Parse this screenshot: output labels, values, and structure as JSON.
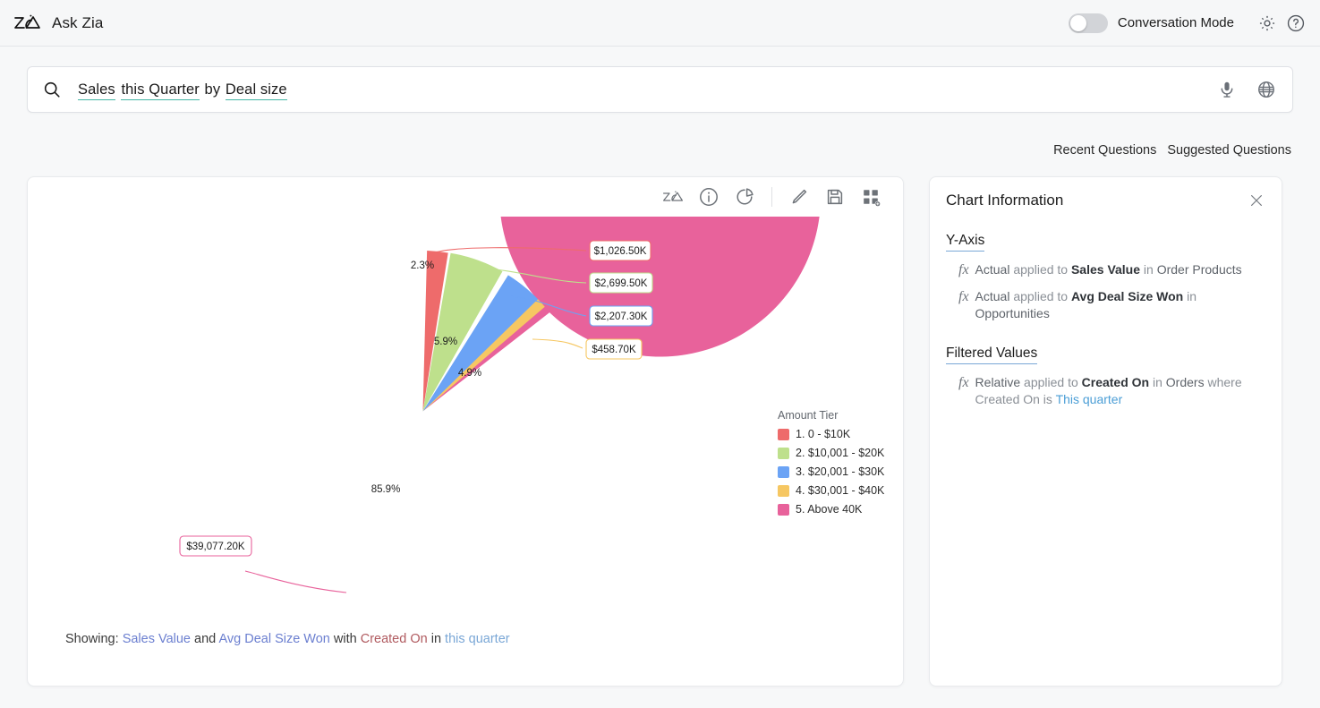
{
  "header": {
    "logo_icon": "zia-logo-icon",
    "title": "Ask Zia",
    "toggle_label": "Conversation Mode",
    "toggle_on": false,
    "settings_icon": "gear-icon",
    "help_icon": "help-circle-icon"
  },
  "search": {
    "icon": "search-icon",
    "tokens": [
      {
        "text": "Sales",
        "underlined": true
      },
      {
        "text": " ",
        "underlined": false
      },
      {
        "text": "this Quarter",
        "underlined": true
      },
      {
        "text": " by ",
        "underlined": false
      },
      {
        "text": "Deal size",
        "underlined": true
      }
    ],
    "full_value": "Sales this Quarter by Deal size",
    "placeholder": "Ask a question",
    "mic_icon": "microphone-icon",
    "globe_icon": "globe-icon"
  },
  "question_links": [
    {
      "label": "Recent Questions"
    },
    {
      "label": "Suggested Questions"
    }
  ],
  "chart_toolbar": [
    {
      "name": "zia-insights-icon"
    },
    {
      "name": "info-circle-icon"
    },
    {
      "name": "pie-chart-icon"
    },
    {
      "name": "divider"
    },
    {
      "name": "edit-pencil-icon"
    },
    {
      "name": "save-disk-icon"
    },
    {
      "name": "widget-grid-icon"
    }
  ],
  "chart_data": {
    "type": "pie",
    "title": "",
    "legend_title": "Amount Tier",
    "legend_position": "right",
    "categories": [
      "1. 0 - $10K",
      "2. $10,001 - $20K",
      "3. $20,001 - $30K",
      "4. $30,001 - $40K",
      "5. Above 40K"
    ],
    "values": [
      1026.5,
      2699.5,
      2207.3,
      458.7,
      39077.2
    ],
    "value_labels": [
      "$1,026.50K",
      "$2,699.50K",
      "$2,207.30K",
      "$458.70K",
      "$39,077.20K"
    ],
    "percent_labels": [
      "2.3%",
      "5.9%",
      "4.9%",
      "1.0%",
      "85.9%"
    ],
    "shown_percent_labels": [
      "2.3%",
      "5.9%",
      "4.9%",
      "85.9%"
    ],
    "colors": [
      "#ee6b6b",
      "#bee08c",
      "#6ba3f5",
      "#f6c762",
      "#e8629b"
    ],
    "unit": "K",
    "xlabel": "",
    "ylabel": ""
  },
  "showing": {
    "prefix": "Showing:",
    "metric1": "Sales Value",
    "conj": "and",
    "metric2": "Avg Deal Size Won",
    "with": "with",
    "field": "Created On",
    "in": "in",
    "period": "this quarter"
  },
  "info_panel": {
    "title": "Chart Information",
    "close_icon": "close-icon",
    "sections": [
      {
        "title": "Y-Axis",
        "rows": [
          {
            "glyph": "fx",
            "p1": "Actual",
            "p2": " applied to ",
            "bold": "Sales Value",
            "p3": " in ",
            "p4": "Order Products",
            "p5": "",
            "link": ""
          },
          {
            "glyph": "fx",
            "p1": "Actual",
            "p2": " applied to ",
            "bold": "Avg Deal Size Won",
            "p3": " in ",
            "p4": "Opportunities",
            "p5": "",
            "link": ""
          }
        ]
      },
      {
        "title": "Filtered Values",
        "rows": [
          {
            "glyph": "fx",
            "p1": "Relative",
            "p2": " applied to ",
            "bold": "Created On",
            "p3": " in ",
            "p4": "Orders",
            "p5": " where Created On is ",
            "link": "This quarter"
          }
        ]
      }
    ]
  }
}
